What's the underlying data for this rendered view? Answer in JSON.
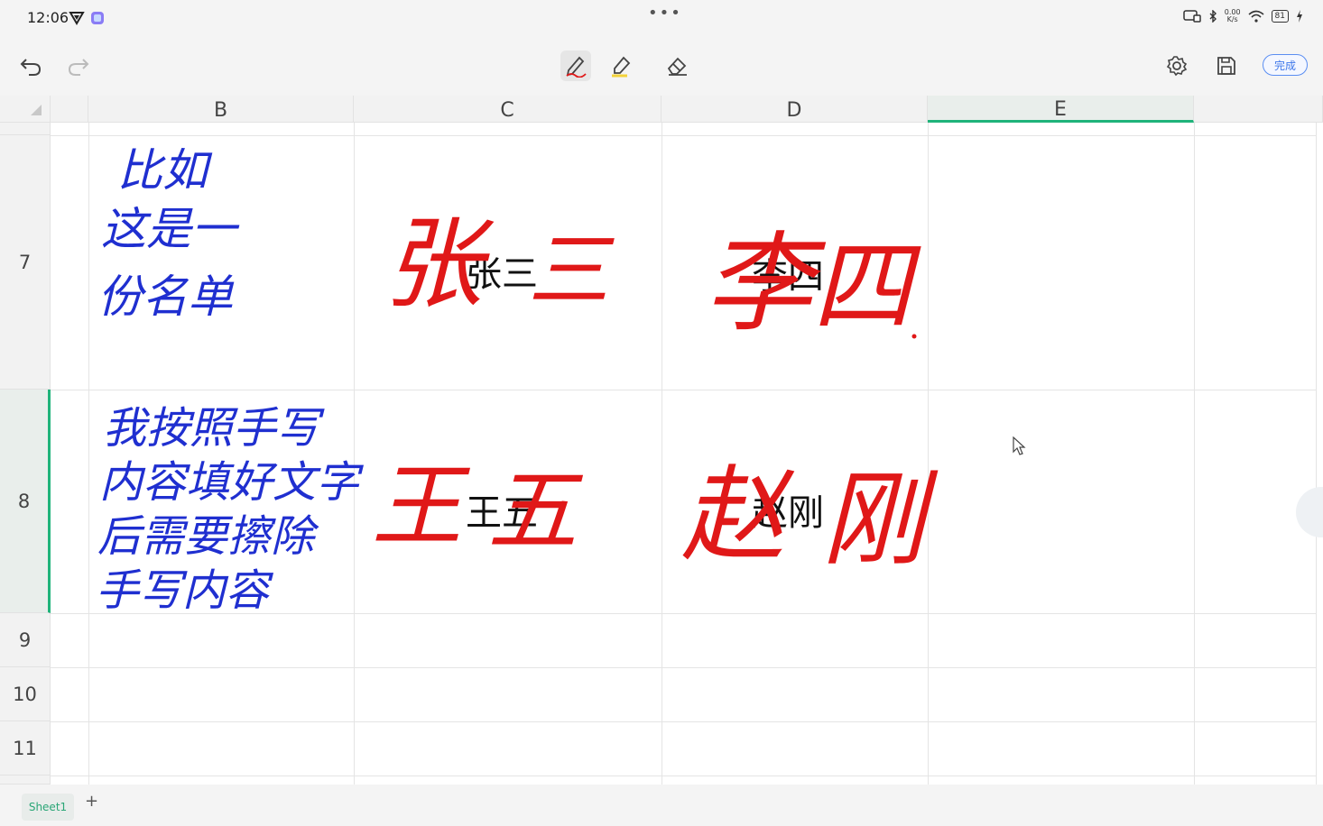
{
  "status_bar": {
    "time": "12:06",
    "net_speed_top": "0.00",
    "net_speed_bottom": "K/s",
    "battery": "81",
    "more": "•••"
  },
  "toolbar": {
    "undo_icon": "undo-icon",
    "redo_icon": "redo-icon",
    "pen_icon": "pen-icon",
    "highlighter_icon": "highlighter-icon",
    "eraser_icon": "eraser-icon",
    "settings_icon": "gear-icon",
    "save_icon": "save-icon",
    "done_label": "完成",
    "accent": "#3f78ea"
  },
  "grid": {
    "columns": [
      "B",
      "C",
      "D",
      "E"
    ],
    "selected_column": "E",
    "rows": [
      "7",
      "8",
      "9",
      "10",
      "11"
    ],
    "selected_row": "8",
    "selection_color": "#1fb37a"
  },
  "cells": {
    "C7": "张三",
    "D7": "李四",
    "C8": "王五",
    "D8": "赵刚"
  },
  "handwriting": {
    "blue_color": "#1f2fd0",
    "red_color": "#e01818",
    "b7_lines": [
      "比如",
      "这是一",
      "份名单"
    ],
    "b8_lines": [
      "我按照手写",
      "内容填好文字",
      "后需要擦除",
      "手写内容"
    ],
    "c7": [
      "张",
      "三"
    ],
    "d7": [
      "李",
      "四"
    ],
    "c8": [
      "王",
      "五"
    ],
    "d8": [
      "赵",
      "刚"
    ]
  },
  "tabs": {
    "sheet_name": "Sheet1",
    "add": "+"
  }
}
